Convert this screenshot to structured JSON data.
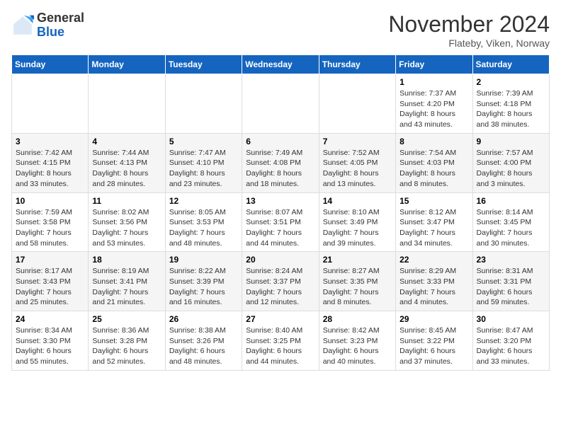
{
  "header": {
    "logo_line1": "General",
    "logo_line2": "Blue",
    "month_title": "November 2024",
    "location": "Flateby, Viken, Norway"
  },
  "weekdays": [
    "Sunday",
    "Monday",
    "Tuesday",
    "Wednesday",
    "Thursday",
    "Friday",
    "Saturday"
  ],
  "weeks": [
    [
      {
        "day": "",
        "info": ""
      },
      {
        "day": "",
        "info": ""
      },
      {
        "day": "",
        "info": ""
      },
      {
        "day": "",
        "info": ""
      },
      {
        "day": "",
        "info": ""
      },
      {
        "day": "1",
        "info": "Sunrise: 7:37 AM\nSunset: 4:20 PM\nDaylight: 8 hours and 43 minutes."
      },
      {
        "day": "2",
        "info": "Sunrise: 7:39 AM\nSunset: 4:18 PM\nDaylight: 8 hours and 38 minutes."
      }
    ],
    [
      {
        "day": "3",
        "info": "Sunrise: 7:42 AM\nSunset: 4:15 PM\nDaylight: 8 hours and 33 minutes."
      },
      {
        "day": "4",
        "info": "Sunrise: 7:44 AM\nSunset: 4:13 PM\nDaylight: 8 hours and 28 minutes."
      },
      {
        "day": "5",
        "info": "Sunrise: 7:47 AM\nSunset: 4:10 PM\nDaylight: 8 hours and 23 minutes."
      },
      {
        "day": "6",
        "info": "Sunrise: 7:49 AM\nSunset: 4:08 PM\nDaylight: 8 hours and 18 minutes."
      },
      {
        "day": "7",
        "info": "Sunrise: 7:52 AM\nSunset: 4:05 PM\nDaylight: 8 hours and 13 minutes."
      },
      {
        "day": "8",
        "info": "Sunrise: 7:54 AM\nSunset: 4:03 PM\nDaylight: 8 hours and 8 minutes."
      },
      {
        "day": "9",
        "info": "Sunrise: 7:57 AM\nSunset: 4:00 PM\nDaylight: 8 hours and 3 minutes."
      }
    ],
    [
      {
        "day": "10",
        "info": "Sunrise: 7:59 AM\nSunset: 3:58 PM\nDaylight: 7 hours and 58 minutes."
      },
      {
        "day": "11",
        "info": "Sunrise: 8:02 AM\nSunset: 3:56 PM\nDaylight: 7 hours and 53 minutes."
      },
      {
        "day": "12",
        "info": "Sunrise: 8:05 AM\nSunset: 3:53 PM\nDaylight: 7 hours and 48 minutes."
      },
      {
        "day": "13",
        "info": "Sunrise: 8:07 AM\nSunset: 3:51 PM\nDaylight: 7 hours and 44 minutes."
      },
      {
        "day": "14",
        "info": "Sunrise: 8:10 AM\nSunset: 3:49 PM\nDaylight: 7 hours and 39 minutes."
      },
      {
        "day": "15",
        "info": "Sunrise: 8:12 AM\nSunset: 3:47 PM\nDaylight: 7 hours and 34 minutes."
      },
      {
        "day": "16",
        "info": "Sunrise: 8:14 AM\nSunset: 3:45 PM\nDaylight: 7 hours and 30 minutes."
      }
    ],
    [
      {
        "day": "17",
        "info": "Sunrise: 8:17 AM\nSunset: 3:43 PM\nDaylight: 7 hours and 25 minutes."
      },
      {
        "day": "18",
        "info": "Sunrise: 8:19 AM\nSunset: 3:41 PM\nDaylight: 7 hours and 21 minutes."
      },
      {
        "day": "19",
        "info": "Sunrise: 8:22 AM\nSunset: 3:39 PM\nDaylight: 7 hours and 16 minutes."
      },
      {
        "day": "20",
        "info": "Sunrise: 8:24 AM\nSunset: 3:37 PM\nDaylight: 7 hours and 12 minutes."
      },
      {
        "day": "21",
        "info": "Sunrise: 8:27 AM\nSunset: 3:35 PM\nDaylight: 7 hours and 8 minutes."
      },
      {
        "day": "22",
        "info": "Sunrise: 8:29 AM\nSunset: 3:33 PM\nDaylight: 7 hours and 4 minutes."
      },
      {
        "day": "23",
        "info": "Sunrise: 8:31 AM\nSunset: 3:31 PM\nDaylight: 6 hours and 59 minutes."
      }
    ],
    [
      {
        "day": "24",
        "info": "Sunrise: 8:34 AM\nSunset: 3:30 PM\nDaylight: 6 hours and 55 minutes."
      },
      {
        "day": "25",
        "info": "Sunrise: 8:36 AM\nSunset: 3:28 PM\nDaylight: 6 hours and 52 minutes."
      },
      {
        "day": "26",
        "info": "Sunrise: 8:38 AM\nSunset: 3:26 PM\nDaylight: 6 hours and 48 minutes."
      },
      {
        "day": "27",
        "info": "Sunrise: 8:40 AM\nSunset: 3:25 PM\nDaylight: 6 hours and 44 minutes."
      },
      {
        "day": "28",
        "info": "Sunrise: 8:42 AM\nSunset: 3:23 PM\nDaylight: 6 hours and 40 minutes."
      },
      {
        "day": "29",
        "info": "Sunrise: 8:45 AM\nSunset: 3:22 PM\nDaylight: 6 hours and 37 minutes."
      },
      {
        "day": "30",
        "info": "Sunrise: 8:47 AM\nSunset: 3:20 PM\nDaylight: 6 hours and 33 minutes."
      }
    ]
  ]
}
